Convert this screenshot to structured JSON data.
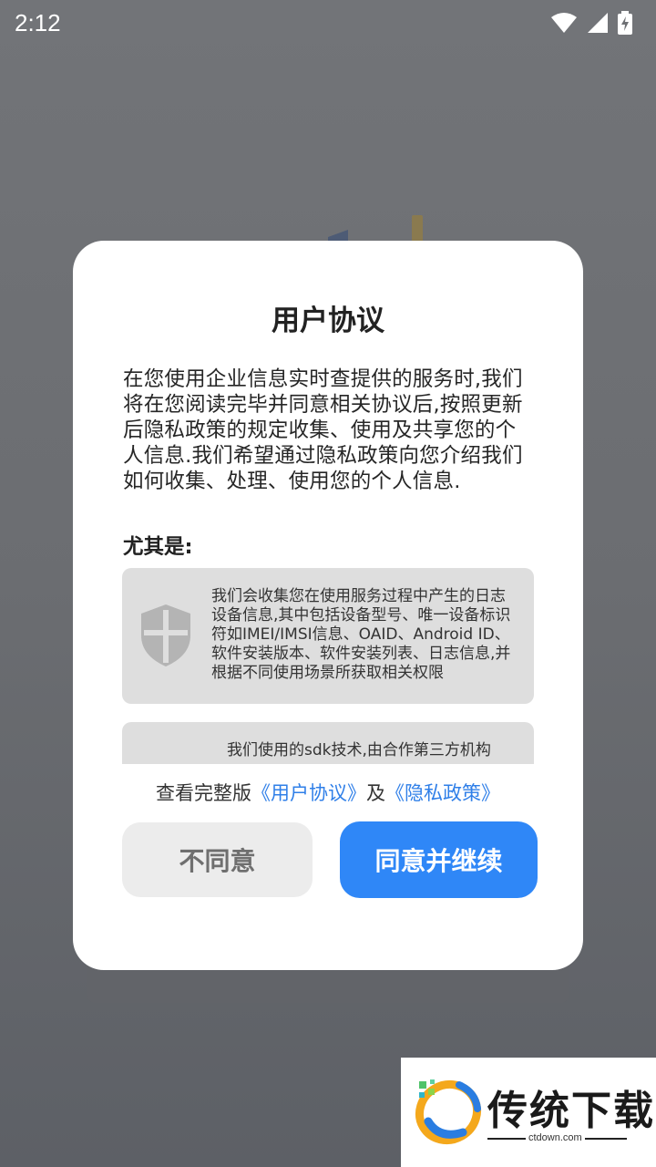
{
  "status_bar": {
    "time": "2:12",
    "icons": [
      "wifi-icon",
      "cell-signal-icon",
      "battery-charging-icon"
    ]
  },
  "dialog": {
    "title": "用户协议",
    "body": "在您使用企业信息实时查提供的服务时,我们将在您阅读完毕并同意相关协议后,按照更新后隐私政策的规定收集、使用及共享您的个人信息.我们希望通过隐私政策向您介绍我们如何收集、处理、使用您的个人信息.",
    "subheading": "尤其是:",
    "cards": [
      {
        "icon": "shield-icon",
        "text": "我们会收集您在使用服务过程中产生的日志 设备信息,其中包括设备型号、唯一设备标识符如IMEI/IMSI信息、OAID、Android ID、软件安装版本、软件安装列表、日志信息,并根据不同使用场景所获取相关权限"
      },
      {
        "text": "我们使用的sdk技术,由合作第三方机构"
      }
    ],
    "links": {
      "prefix": "查看完整版",
      "user_agreement": "《用户协议》",
      "conjunction": "及",
      "privacy_policy": "《隐私政策》"
    },
    "buttons": {
      "disagree": "不同意",
      "agree": "同意并继续"
    }
  },
  "watermark": {
    "title": "传统下载",
    "url": "ctdown.com"
  },
  "colors": {
    "accent": "#2f87f7",
    "link": "#2f7fe8",
    "overlay": "#6e7074"
  }
}
